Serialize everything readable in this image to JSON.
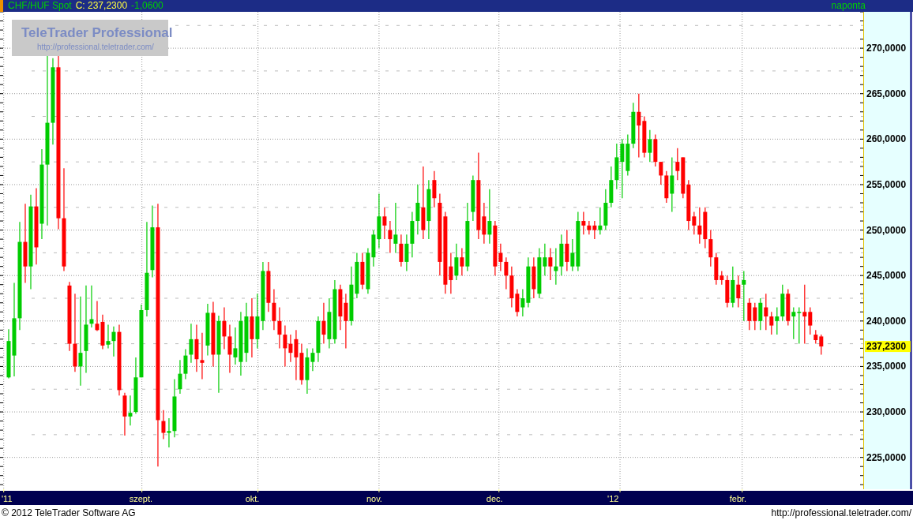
{
  "header": {
    "symbol": "CHF/HUF Spot",
    "close_label": "C: 237,2300",
    "change": "-1,0600",
    "interval": "naponta"
  },
  "logo": {
    "title": "TeleTrader Professional",
    "url": "http://professional.teletrader.com/"
  },
  "chart": {
    "price_axis": {
      "labels": [
        "270,0000",
        "265,0000",
        "260,0000",
        "255,0000",
        "250,0000",
        "245,0000",
        "240,0000",
        "235,0000",
        "230,0000",
        "225,0000"
      ],
      "last_price": "237,2300"
    },
    "time_axis": {
      "labels": [
        "'11",
        "szept.",
        "okt.",
        "nov.",
        "dec.",
        "'12",
        "febr."
      ]
    }
  },
  "footer": {
    "copyright": "© 2012 TeleTrader Software AG",
    "url": "http://professional.teletrader.com/"
  }
}
